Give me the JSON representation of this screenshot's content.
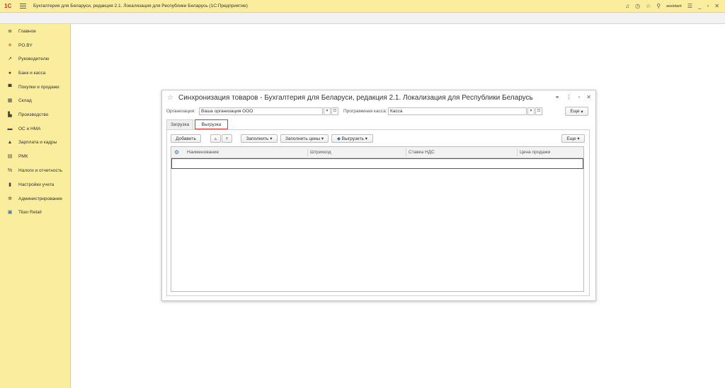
{
  "app": {
    "logo": "1С",
    "title": "Бухгалтерия для Беларуси, редакция 2.1. Локализация для Республики Беларусь   (1С:Предприятие)",
    "user": "assistant"
  },
  "sidebar": {
    "items": [
      {
        "label": "Главное",
        "icon": "≣"
      },
      {
        "label": "PO.BY",
        "icon": "✳"
      },
      {
        "label": "Руководителю",
        "icon": "↗"
      },
      {
        "label": "Банк и касса",
        "icon": "●"
      },
      {
        "label": "Покупки и продажи",
        "icon": "▀"
      },
      {
        "label": "Склад",
        "icon": "▦"
      },
      {
        "label": "Производство",
        "icon": "▙"
      },
      {
        "label": "ОС и НМА",
        "icon": "▬"
      },
      {
        "label": "Зарплата и кадры",
        "icon": "▲"
      },
      {
        "label": "РМК",
        "icon": "▤"
      },
      {
        "label": "Налоги и отчетность",
        "icon": "%"
      },
      {
        "label": "Настройки учета",
        "icon": "▮"
      },
      {
        "label": "Администрирование",
        "icon": "✲"
      },
      {
        "label": "Titan Retail",
        "icon": "▣"
      }
    ]
  },
  "dialog": {
    "title": "Синхронизация товаров - Бухгалтерия для Беларуси, редакция 2.1. Локализация для Республики Беларусь",
    "org_label": "Организация:",
    "org_value": "Ваша организация ООО",
    "kassa_label": "Программная касса:",
    "kassa_value": "Касса",
    "more_label": "Еще",
    "tabs": {
      "load": "Загрузка",
      "unload": "Выгрузка"
    },
    "toolbar": {
      "add": "Добавить",
      "up": "▲",
      "down": "▼",
      "fill": "Заполнить",
      "fill_prices": "Заполнить цены",
      "export": "Выгрузить",
      "more": "Еще"
    },
    "table": {
      "columns": [
        "Наименование",
        "Штрихкод",
        "Ставка НДС",
        "Цена продажи"
      ]
    }
  },
  "colors": {
    "titlebar": "#fbed9e",
    "sidebar": "#fbed9e",
    "active_tab_border": "#d93a30"
  }
}
